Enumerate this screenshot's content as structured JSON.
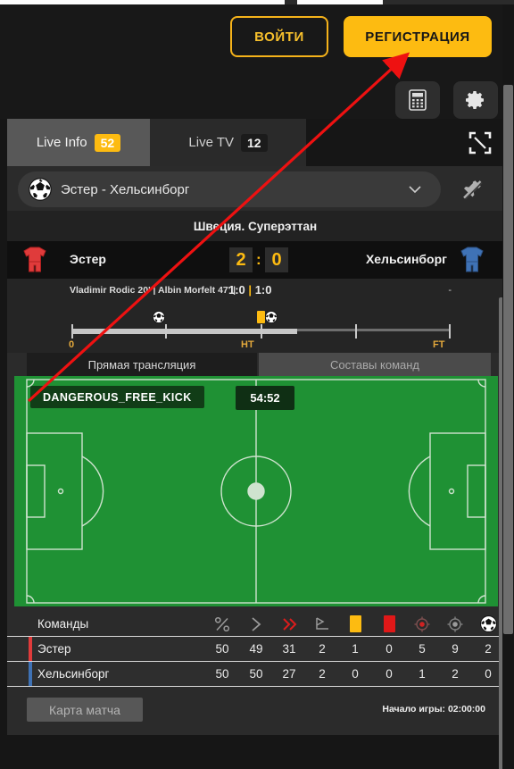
{
  "header": {
    "login_label": "ВОЙТИ",
    "register_label": "РЕГИСТРАЦИЯ",
    "calculator_icon": "calculator-icon",
    "settings_icon": "gear-icon"
  },
  "tabs": [
    {
      "label": "Live Info",
      "badge": "52",
      "active": true
    },
    {
      "label": "Live TV",
      "badge": "12",
      "active": false
    }
  ],
  "fullscreen_icon": "fullscreen-icon",
  "match_selector": {
    "sport_icon": "football-icon",
    "value": "Эстер - Хельсинборг",
    "chevron_icon": "chevron-down-icon",
    "pin_icon": "pin-off-icon"
  },
  "league": "Швеция. Суперэттан",
  "scoreboard": {
    "home_team": "Эстер",
    "away_team": "Хельсинборг",
    "home_score": "2",
    "away_score": "0",
    "separator": ":",
    "home_shirt_icon": "jersey-red-icon",
    "away_shirt_icon": "jersey-blue-icon"
  },
  "scorers": {
    "text": "Vladimir Rodic 20' | Albin Morfelt 47' |",
    "periods_home": "1:0",
    "periods_sep": "|",
    "periods_away": "1:0",
    "away_dash": "-"
  },
  "timeline": {
    "start_label": "0",
    "half_label": "HT",
    "full_label": "FT",
    "events": [
      {
        "icon": "football-icon",
        "pos_pct": 28
      },
      {
        "icon": "yellow-card-icon",
        "pos_pct": 59
      },
      {
        "icon": "football-icon",
        "pos_pct": 61
      }
    ]
  },
  "subtabs": [
    {
      "label": "Прямая трансляция",
      "active": true
    },
    {
      "label": "Составы команд",
      "active": false
    }
  ],
  "pitch": {
    "event_label": "DANGEROUS_FREE_KICK",
    "clock": "54:52"
  },
  "stats": {
    "header_label": "Команды",
    "columns": [
      {
        "icon": "percent-icon",
        "name": "possession"
      },
      {
        "icon": "chevron-right-icon",
        "name": "attacks"
      },
      {
        "icon": "double-chevron-right-red-icon",
        "name": "dangerous-attacks"
      },
      {
        "icon": "corner-flag-icon",
        "name": "corners"
      },
      {
        "icon": "yellow-card-icon",
        "name": "yellow-cards"
      },
      {
        "icon": "red-card-icon",
        "name": "red-cards"
      },
      {
        "icon": "shot-on-target-icon",
        "name": "shots-on-target"
      },
      {
        "icon": "shot-off-target-icon",
        "name": "shots-off-target"
      },
      {
        "icon": "football-icon",
        "name": "goals"
      }
    ],
    "rows": [
      {
        "team": "Эстер",
        "color": "#e03b3b",
        "values": [
          "50",
          "49",
          "31",
          "2",
          "1",
          "0",
          "5",
          "9",
          "2"
        ]
      },
      {
        "team": "Хельсинборг",
        "color": "#3f72b5",
        "values": [
          "50",
          "50",
          "27",
          "2",
          "0",
          "0",
          "1",
          "2",
          "0"
        ]
      }
    ]
  },
  "footer": {
    "map_button": "Карта матча",
    "start_time": "Начало игры: 02:00:00"
  },
  "colors": {
    "accent": "#fdbb11",
    "pitch": "#1f9134",
    "red": "#e03b3b",
    "blue": "#3f72b5",
    "arrow": "#ee1111"
  }
}
